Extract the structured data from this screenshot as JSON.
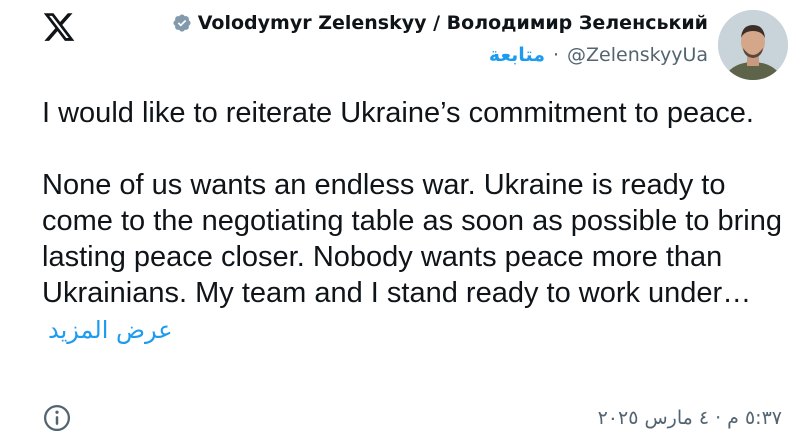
{
  "header": {
    "display_name": "Volodymyr Zelenskyy / Володимир Зеленський",
    "handle": "@ZelenskyyUa",
    "separator": "·",
    "follow_label": "متابعة"
  },
  "tweet": {
    "paragraph_1": "I would like to reiterate Ukraine’s commitment to peace.",
    "paragraph_2": "None of us wants an endless war. Ukraine is ready to come to the negotiating table as soon as possible to bring lasting peace closer. Nobody wants peace more than Ukrainians. My team and I stand ready to work under…",
    "show_more": "عرض المزيد"
  },
  "footer": {
    "timestamp": "٥:٣٧ م · ٤ مارس ٢٠٢٥"
  },
  "icons": {
    "logo": "x-logo-icon",
    "verified": "verified-badge-icon",
    "info": "info-icon"
  },
  "colors": {
    "accent": "#1d9bf0",
    "text": "#0f1419",
    "secondary": "#536471",
    "verified_badge": "#829aab"
  }
}
